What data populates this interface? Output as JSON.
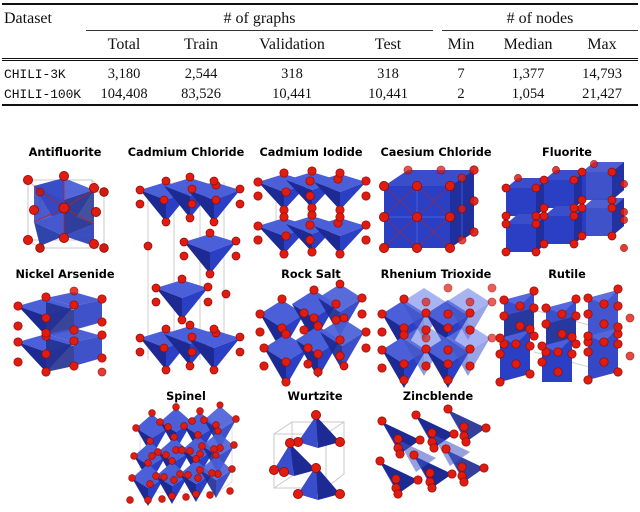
{
  "table": {
    "group_headers": {
      "graphs": "# of graphs",
      "nodes": "# of nodes"
    },
    "columns": {
      "dataset": "Dataset",
      "total": "Total",
      "train": "Train",
      "validation": "Validation",
      "test": "Test",
      "min": "Min",
      "median": "Median",
      "max": "Max"
    },
    "rows": [
      {
        "dataset": "CHILI-3K",
        "total": "3,180",
        "train": "2,544",
        "validation": "318",
        "test": "318",
        "min": "7",
        "median": "1,377",
        "max": "14,793"
      },
      {
        "dataset": "CHILI-100K",
        "total": "104,408",
        "train": "83,526",
        "validation": "10,441",
        "test": "10,441",
        "min": "2",
        "median": "1,054",
        "max": "21,427"
      }
    ]
  },
  "figure": {
    "structures": [
      {
        "label": "Antifluorite",
        "kind": "octahedra-cube",
        "row": 1,
        "col": 1
      },
      {
        "label": "Cadmium Chloride",
        "kind": "layered-tall",
        "row": 1,
        "col": 2
      },
      {
        "label": "Cadmium Iodide",
        "kind": "layered-two",
        "row": 1,
        "col": 3
      },
      {
        "label": "Caesium Chloride",
        "kind": "solid-cube",
        "row": 1,
        "col": 4
      },
      {
        "label": "Fluorite",
        "kind": "cube-grid",
        "row": 1,
        "col": 5
      },
      {
        "label": "Nickel Arsenide",
        "kind": "octahedra-stack",
        "row": 2,
        "col": 1
      },
      {
        "label": "Rock Salt",
        "kind": "octahedra-grid",
        "row": 2,
        "col": 3
      },
      {
        "label": "Rhenium Trioxide",
        "kind": "corner-octa",
        "row": 2,
        "col": 4
      },
      {
        "label": "Rutile",
        "kind": "rutile-chains",
        "row": 2,
        "col": 5
      },
      {
        "label": "Spinel",
        "kind": "spinel-cluster",
        "row": 3,
        "col": 2
      },
      {
        "label": "Wurtzite",
        "kind": "tetra-cell",
        "row": 3,
        "col": 3
      },
      {
        "label": "Zincblende",
        "kind": "tetra-grid",
        "row": 3,
        "col": 4
      }
    ],
    "colors": {
      "polyhedron_blue": "#2b3fc4",
      "polyhedron_blue_light": "#4a5fd8",
      "polyhedron_blue_dark": "#1d2a93",
      "atom_red": "#e01b10",
      "atom_red_dark": "#9c0d06",
      "cell_edge_gray": "#bdbdbd",
      "bond_red": "#c02018"
    }
  }
}
